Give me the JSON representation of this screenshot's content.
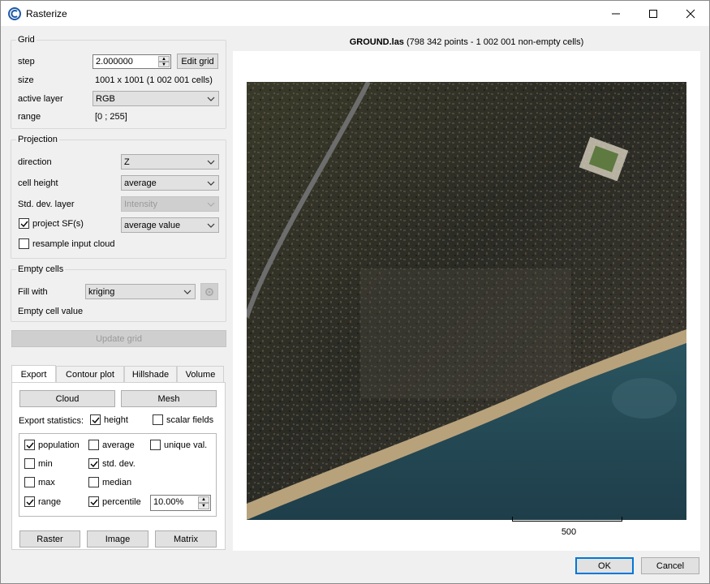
{
  "window": {
    "title": "Rasterize"
  },
  "grid": {
    "title": "Grid",
    "step_label": "step",
    "step_value": "2.000000",
    "edit_grid": "Edit grid",
    "size_label": "size",
    "size_value": "1001 x 1001 (1 002 001 cells)",
    "active_layer_label": "active layer",
    "active_layer_value": "RGB",
    "range_label": "range",
    "range_value": "[0 ; 255]"
  },
  "projection": {
    "title": "Projection",
    "direction_label": "direction",
    "direction_value": "Z",
    "cell_height_label": "cell height",
    "cell_height_value": "average",
    "std_dev_label": "Std. dev. layer",
    "std_dev_value": "Intensity",
    "project_sf_label": "project SF(s)",
    "project_sf_value": "average value",
    "resample_label": "resample input cloud"
  },
  "empty_cells": {
    "title": "Empty cells",
    "fill_with_label": "Fill with",
    "fill_with_value": "kriging",
    "empty_value_label": "Empty cell value"
  },
  "update_grid": "Update grid",
  "tabs": [
    "Export",
    "Contour plot",
    "Hillshade",
    "Volume"
  ],
  "export": {
    "cloud": "Cloud",
    "mesh": "Mesh",
    "stats_label": "Export statistics:",
    "height": "height",
    "scalar_fields": "scalar fields",
    "population": "population",
    "average": "average",
    "unique": "unique val.",
    "min": "min",
    "std_dev": "std. dev.",
    "max": "max",
    "median": "median",
    "range": "range",
    "percentile": "percentile",
    "percentile_value": "10.00%",
    "raster": "Raster",
    "image": "Image",
    "matrix": "Matrix"
  },
  "preview": {
    "filename": "GROUND.las",
    "info": " (798 342 points - 1 002 001 non-empty cells)",
    "scale_label": "500"
  },
  "footer": {
    "ok": "OK",
    "cancel": "Cancel"
  }
}
